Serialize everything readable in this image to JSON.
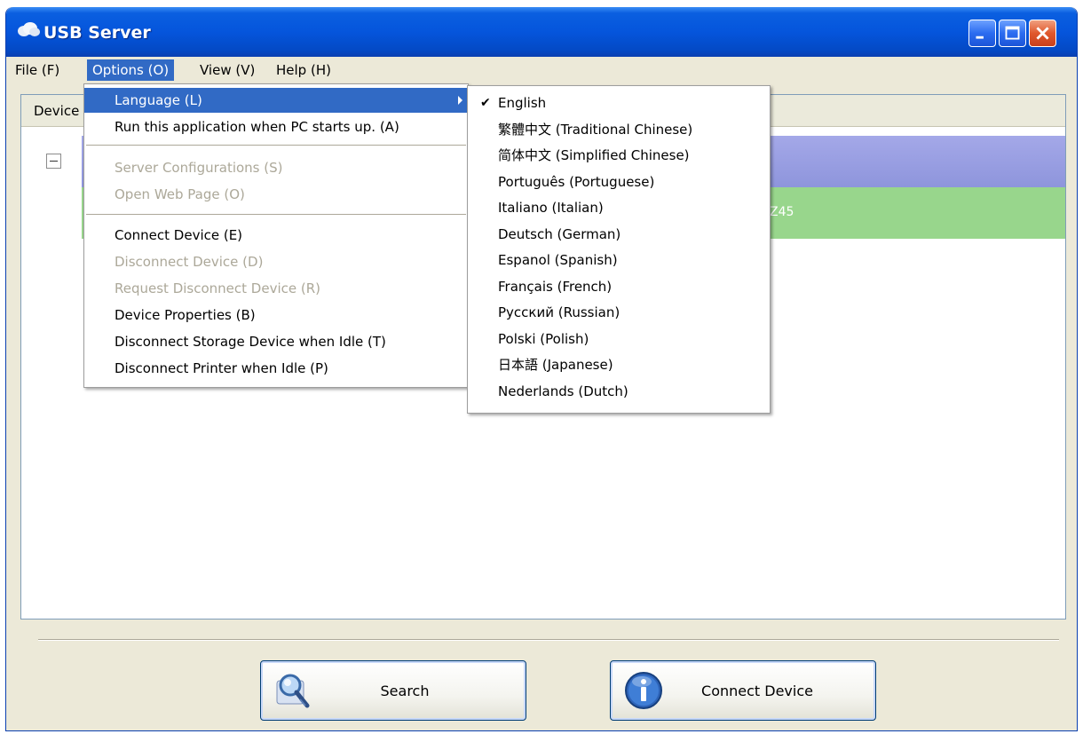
{
  "window": {
    "title": "USB Server"
  },
  "menubar": {
    "items": [
      "File (F)",
      "Options (O)",
      "View (V)",
      "Help (H)"
    ]
  },
  "listview": {
    "column_header": "Device",
    "green_row_text": "Z45"
  },
  "options_menu": {
    "language": "Language (L)",
    "run_on_startup": "Run this application when PC starts up. (A)",
    "server_configurations": "Server Configurations (S)",
    "open_web_page": "Open Web Page (O)",
    "connect_device": "Connect Device (E)",
    "disconnect_device": "Disconnect Device (D)",
    "request_disconnect_device": "Request Disconnect Device (R)",
    "device_properties": "Device Properties (B)",
    "disconnect_storage_idle": "Disconnect Storage Device when Idle (T)",
    "disconnect_printer_idle": "Disconnect Printer when Idle (P)"
  },
  "language_menu": {
    "check_mark": "✔",
    "items": [
      "English",
      "繁體中文 (Traditional Chinese)",
      "简体中文 (Simplified Chinese)",
      "Português (Portuguese)",
      "Italiano (Italian)",
      "Deutsch (German)",
      "Espanol (Spanish)",
      "Français (French)",
      "Русский (Russian)",
      "Polski (Polish)",
      "日本語 (Japanese)",
      "Nederlands (Dutch)"
    ],
    "selected": "English"
  },
  "buttons": {
    "search": "Search",
    "connect_device": "Connect Device"
  },
  "colors": {
    "titlebar": "#0555dc",
    "highlight": "#316ac5",
    "row_blue": "#9aa0e2",
    "row_green": "#98d68c",
    "disabled_text": "#aca899"
  },
  "icons": {
    "title": "cloud-icon",
    "search": "magnifier-icon",
    "connect": "info-icon"
  }
}
